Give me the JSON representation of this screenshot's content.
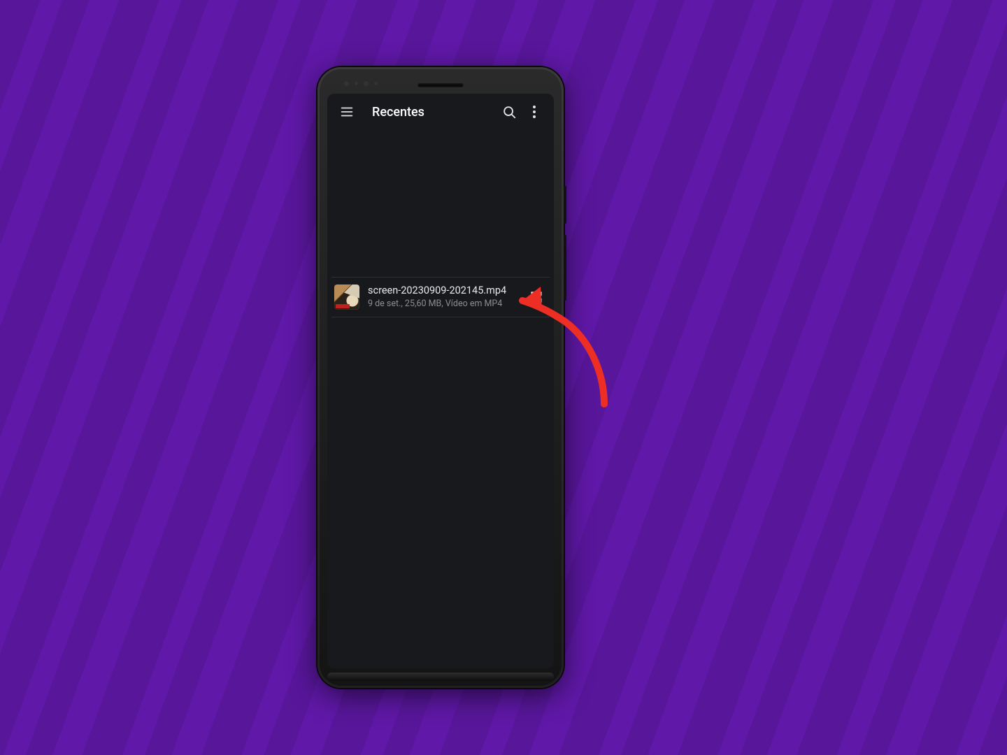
{
  "background": {
    "color": "#5F18A7"
  },
  "appbar": {
    "title": "Recentes",
    "menu_icon": "hamburger-icon",
    "search_icon": "search-icon",
    "more_icon": "more-vert-icon"
  },
  "file": {
    "name": "screen-20230909-202145.mp4",
    "subtitle": "9 de set., 25,60 MB, Vídeo em MP4",
    "expand_icon": "expand-icon"
  },
  "annotation": {
    "arrow_color": "#ED2E24"
  }
}
